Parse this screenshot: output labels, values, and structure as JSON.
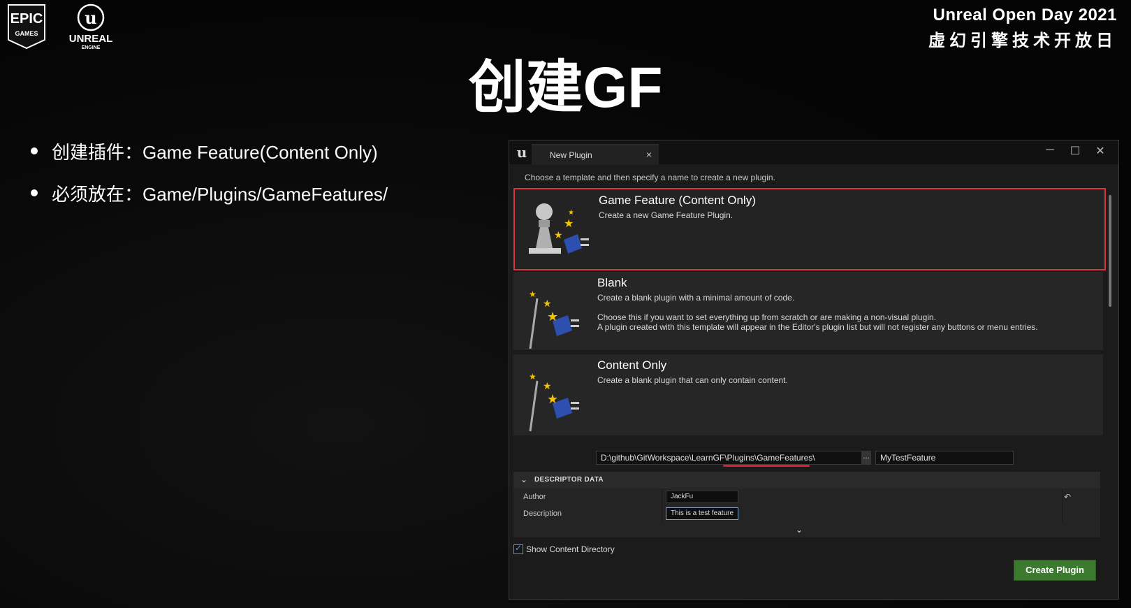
{
  "branding": {
    "epic_line1": "EPIC",
    "epic_line2": "GAMES",
    "unreal_line1": "UNREAL",
    "unreal_line2": "ENGINE",
    "event_line1": "Unreal Open Day 2021",
    "event_line2": "虚幻引擎技术开放日"
  },
  "slide": {
    "title": "创建GF",
    "bullets": [
      {
        "text": "创建插件：Game Feature(Content Only)"
      },
      {
        "text": "必须放在：Game/Plugins/GameFeatures/"
      }
    ]
  },
  "dialog": {
    "tab_label": "New Plugin",
    "tab_close": "×",
    "window_controls": [
      "─",
      "☐",
      "✕"
    ],
    "instruction": "Choose a template and then specify a name to create a new plugin.",
    "templates": [
      {
        "title": "Game Feature (Content Only)",
        "description": "Create a new Game Feature Plugin.",
        "extra_lines": [],
        "icon": "pawn-plugin-icon",
        "selected": true
      },
      {
        "title": "Blank",
        "description": "Create a blank plugin with a minimal amount of code.",
        "extra_lines": [
          "Choose this if you want to set everything up from scratch or are making a non-visual plugin.",
          "A plugin created with this template will appear in the Editor's plugin list but will not register any buttons or menu entries."
        ],
        "icon": "wand-plugin-icon",
        "selected": false
      },
      {
        "title": "Content Only",
        "description": "Create a blank plugin that can only contain content.",
        "extra_lines": [],
        "icon": "wand-plugin-icon",
        "selected": false
      }
    ],
    "path_value": "D:\\github\\GitWorkspace\\LearnGF\\Plugins\\GameFeatures\\",
    "browse_label": "...",
    "plugin_name_value": "MyTestFeature",
    "descriptor_header": "DESCRIPTOR DATA",
    "author_label": "Author",
    "author_value": "JackFu",
    "description_label": "Description",
    "description_value": "This is a test feature",
    "show_content_label": "Show Content Directory",
    "show_content_checked": true,
    "create_button": "Create Plugin",
    "colors": {
      "selection_border": "#d8343f",
      "create_button": "#3c7a30",
      "checkmark": "#4a9cff"
    }
  }
}
